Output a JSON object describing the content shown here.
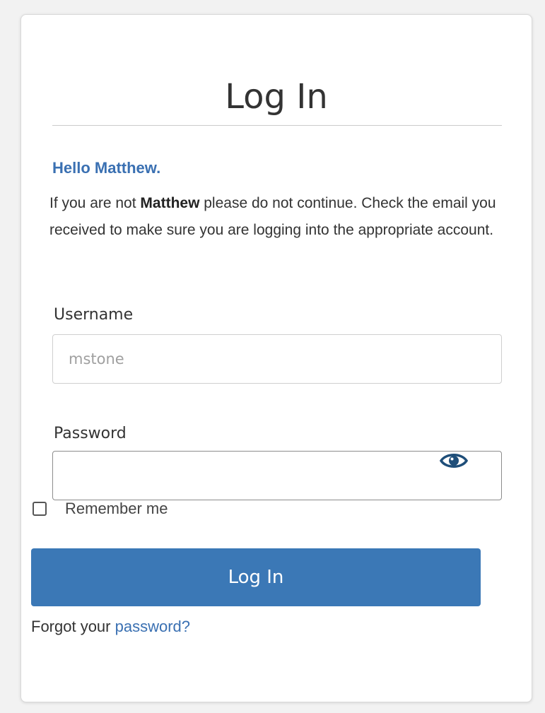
{
  "login": {
    "title": "Log In",
    "greeting": "Hello Matthew.",
    "notice": {
      "prefix": "If you are not ",
      "name": "Matthew",
      "suffix": " please do not continue. Check the email you received to make sure you are logging into the appropriate account."
    },
    "username": {
      "label": "Username",
      "placeholder": "mstone",
      "value": ""
    },
    "password": {
      "label": "Password",
      "value": "",
      "toggle_icon": "eye-icon"
    },
    "remember_me": {
      "label": "Remember me",
      "checked": false
    },
    "submit_label": "Log In",
    "forgot": {
      "prefix": "Forgot your ",
      "link_text": "password?"
    }
  },
  "colors": {
    "accent": "#3b78b6",
    "link": "#3a70b2",
    "background": "#f2f2f2",
    "card": "#ffffff"
  }
}
